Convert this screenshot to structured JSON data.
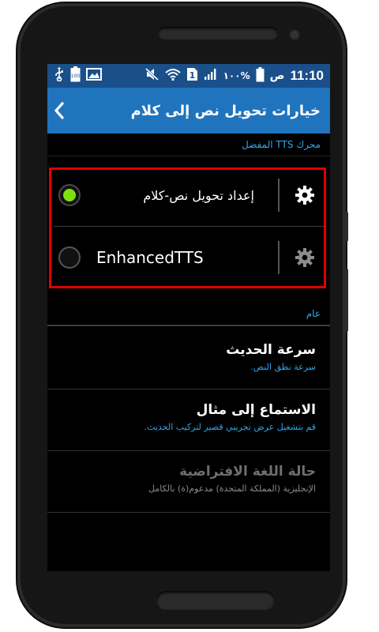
{
  "status_bar": {
    "time": "11:10",
    "am_pm": "ص",
    "battery_percent": "١٠٠%",
    "sim_slot": "1",
    "battery_badge": "100"
  },
  "action_bar": {
    "title": "خيارات تحويل نص إلى كلام"
  },
  "preferred_engine_section": {
    "header": "محرك TTS المفضل",
    "engines": [
      {
        "label": "إعداد تحويل نص-كلام",
        "selected": true
      },
      {
        "label": "EnhancedTTS",
        "selected": false
      }
    ]
  },
  "general_section": {
    "header": "عام",
    "items": [
      {
        "title": "سرعة الحديث",
        "subtitle": "سرعة نطق النص."
      },
      {
        "title": "الاستماع إلى مثال",
        "subtitle": "قم بتشغيل عرض تجريبي قصير لتركيب الحديث."
      },
      {
        "title": "حالة اللغة الافتراضية",
        "subtitle": "الإنجليزية (المملكة المتحدة) مدعوم(ة) بالكامل"
      }
    ]
  },
  "colors": {
    "status_bar": "#1a4f8a",
    "action_bar": "#1f74bd",
    "accent": "#2ea7e8",
    "radio_on": "#7ee10f",
    "highlight": "#e00000"
  },
  "icons": [
    "usb-icon",
    "battery-full-icon",
    "image-icon",
    "mute-icon",
    "wifi-icon",
    "sim-icon",
    "signal-icon",
    "battery-icon",
    "back-chevron-icon",
    "gear-icon"
  ]
}
